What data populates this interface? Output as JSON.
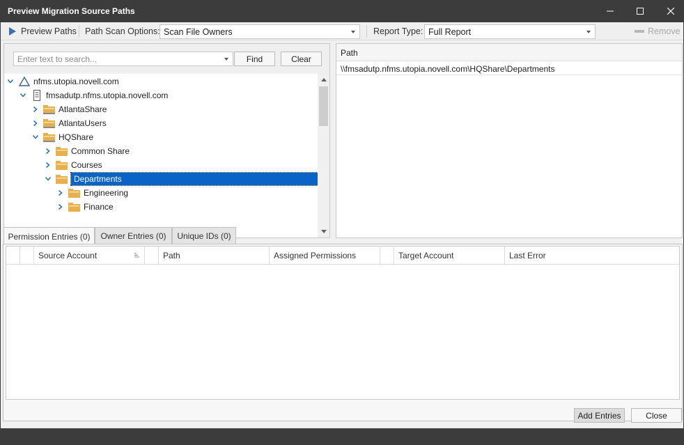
{
  "window": {
    "title": "Preview Migration Source Paths"
  },
  "toolbar": {
    "preview_label": "Preview Paths",
    "scan_options_label": "Path Scan Options:",
    "scan_options_value": "Scan File Owners",
    "report_type_label": "Report Type:",
    "report_type_value": "Full Report",
    "remove_label": "Remove"
  },
  "search": {
    "placeholder": "Enter text to search...",
    "find_label": "Find",
    "clear_label": "Clear"
  },
  "tree": {
    "nodes": [
      {
        "label": "nfms.utopia.novell.com",
        "icon": "tree-icon"
      },
      {
        "label": "fmsadutp.nfms.utopia.novell.com",
        "icon": "server-icon"
      },
      {
        "label": "AtlantaShare",
        "icon": "share-folder-icon"
      },
      {
        "label": "AtlantaUsers",
        "icon": "share-folder-icon"
      },
      {
        "label": "HQShare",
        "icon": "share-folder-icon"
      },
      {
        "label": "Common Share",
        "icon": "folder-icon"
      },
      {
        "label": "Courses",
        "icon": "folder-icon"
      },
      {
        "label": "Departments",
        "icon": "folder-icon"
      },
      {
        "label": "Engineering",
        "icon": "folder-icon"
      },
      {
        "label": "Finance",
        "icon": "folder-icon"
      }
    ]
  },
  "path_panel": {
    "header": "Path",
    "rows": [
      "\\\\fmsadutp.nfms.utopia.novell.com\\HQShare\\Departments"
    ]
  },
  "tabs": [
    {
      "label": "Permission Entries (0)"
    },
    {
      "label": "Owner Entries (0)"
    },
    {
      "label": "Unique IDs (0)"
    }
  ],
  "grid": {
    "columns": [
      "Source Account",
      "Path",
      "Assigned Permissions",
      "Target Account",
      "Last Error"
    ]
  },
  "buttons": {
    "add_entries": "Add Entries",
    "close": "Close"
  },
  "colors": {
    "titlebar": "#3c3c3c",
    "selection": "#0a64c8",
    "folder": "#e8b04a",
    "accent_play": "#3a6fb0"
  }
}
